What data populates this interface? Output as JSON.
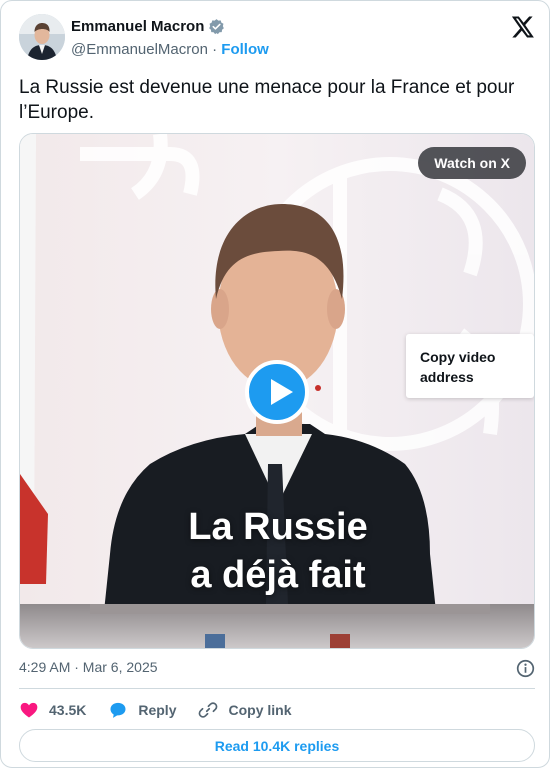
{
  "author": {
    "name": "Emmanuel Macron",
    "handle": "@EmmanuelMacron",
    "separator": " · ",
    "follow_label": "Follow",
    "verified_color": "#829aab"
  },
  "tweet": {
    "text": "La Russie est devenue une menace pour la France et pour l’Europe."
  },
  "media": {
    "watch_label": "Watch on X",
    "copy_menu_label": "Copy video address",
    "caption_line1": "La Russie",
    "caption_line2": "a déjà fait"
  },
  "meta": {
    "timestamp": "4:29 AM · Mar 6, 2025"
  },
  "actions": {
    "likes": "43.5K",
    "reply_label": "Reply",
    "copy_link_label": "Copy link"
  },
  "read_replies_label": "Read 10.4K replies",
  "colors": {
    "accent": "#1d9bf0",
    "like": "#f91880",
    "text": "#0f1419",
    "muted": "#536471"
  }
}
